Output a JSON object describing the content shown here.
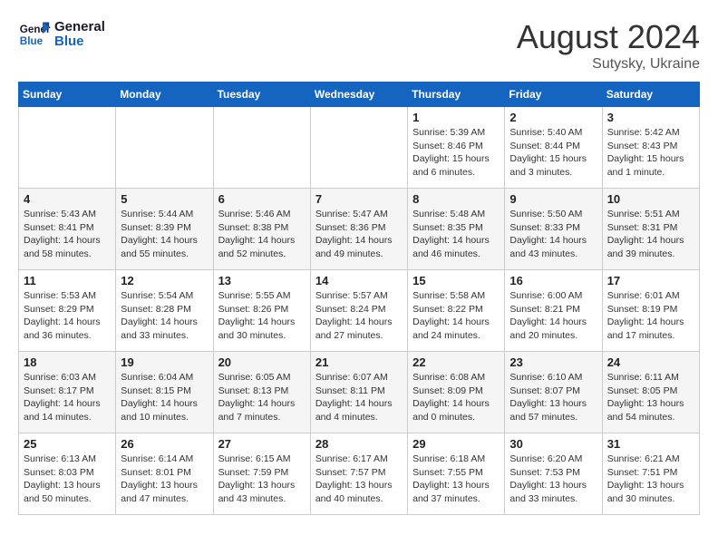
{
  "header": {
    "logo_line1": "General",
    "logo_line2": "Blue",
    "month_year": "August 2024",
    "location": "Sutysky, Ukraine"
  },
  "weekdays": [
    "Sunday",
    "Monday",
    "Tuesday",
    "Wednesday",
    "Thursday",
    "Friday",
    "Saturday"
  ],
  "weeks": [
    [
      {
        "day": "",
        "info": ""
      },
      {
        "day": "",
        "info": ""
      },
      {
        "day": "",
        "info": ""
      },
      {
        "day": "",
        "info": ""
      },
      {
        "day": "1",
        "info": "Sunrise: 5:39 AM\nSunset: 8:46 PM\nDaylight: 15 hours\nand 6 minutes."
      },
      {
        "day": "2",
        "info": "Sunrise: 5:40 AM\nSunset: 8:44 PM\nDaylight: 15 hours\nand 3 minutes."
      },
      {
        "day": "3",
        "info": "Sunrise: 5:42 AM\nSunset: 8:43 PM\nDaylight: 15 hours\nand 1 minute."
      }
    ],
    [
      {
        "day": "4",
        "info": "Sunrise: 5:43 AM\nSunset: 8:41 PM\nDaylight: 14 hours\nand 58 minutes."
      },
      {
        "day": "5",
        "info": "Sunrise: 5:44 AM\nSunset: 8:39 PM\nDaylight: 14 hours\nand 55 minutes."
      },
      {
        "day": "6",
        "info": "Sunrise: 5:46 AM\nSunset: 8:38 PM\nDaylight: 14 hours\nand 52 minutes."
      },
      {
        "day": "7",
        "info": "Sunrise: 5:47 AM\nSunset: 8:36 PM\nDaylight: 14 hours\nand 49 minutes."
      },
      {
        "day": "8",
        "info": "Sunrise: 5:48 AM\nSunset: 8:35 PM\nDaylight: 14 hours\nand 46 minutes."
      },
      {
        "day": "9",
        "info": "Sunrise: 5:50 AM\nSunset: 8:33 PM\nDaylight: 14 hours\nand 43 minutes."
      },
      {
        "day": "10",
        "info": "Sunrise: 5:51 AM\nSunset: 8:31 PM\nDaylight: 14 hours\nand 39 minutes."
      }
    ],
    [
      {
        "day": "11",
        "info": "Sunrise: 5:53 AM\nSunset: 8:29 PM\nDaylight: 14 hours\nand 36 minutes."
      },
      {
        "day": "12",
        "info": "Sunrise: 5:54 AM\nSunset: 8:28 PM\nDaylight: 14 hours\nand 33 minutes."
      },
      {
        "day": "13",
        "info": "Sunrise: 5:55 AM\nSunset: 8:26 PM\nDaylight: 14 hours\nand 30 minutes."
      },
      {
        "day": "14",
        "info": "Sunrise: 5:57 AM\nSunset: 8:24 PM\nDaylight: 14 hours\nand 27 minutes."
      },
      {
        "day": "15",
        "info": "Sunrise: 5:58 AM\nSunset: 8:22 PM\nDaylight: 14 hours\nand 24 minutes."
      },
      {
        "day": "16",
        "info": "Sunrise: 6:00 AM\nSunset: 8:21 PM\nDaylight: 14 hours\nand 20 minutes."
      },
      {
        "day": "17",
        "info": "Sunrise: 6:01 AM\nSunset: 8:19 PM\nDaylight: 14 hours\nand 17 minutes."
      }
    ],
    [
      {
        "day": "18",
        "info": "Sunrise: 6:03 AM\nSunset: 8:17 PM\nDaylight: 14 hours\nand 14 minutes."
      },
      {
        "day": "19",
        "info": "Sunrise: 6:04 AM\nSunset: 8:15 PM\nDaylight: 14 hours\nand 10 minutes."
      },
      {
        "day": "20",
        "info": "Sunrise: 6:05 AM\nSunset: 8:13 PM\nDaylight: 14 hours\nand 7 minutes."
      },
      {
        "day": "21",
        "info": "Sunrise: 6:07 AM\nSunset: 8:11 PM\nDaylight: 14 hours\nand 4 minutes."
      },
      {
        "day": "22",
        "info": "Sunrise: 6:08 AM\nSunset: 8:09 PM\nDaylight: 14 hours\nand 0 minutes."
      },
      {
        "day": "23",
        "info": "Sunrise: 6:10 AM\nSunset: 8:07 PM\nDaylight: 13 hours\nand 57 minutes."
      },
      {
        "day": "24",
        "info": "Sunrise: 6:11 AM\nSunset: 8:05 PM\nDaylight: 13 hours\nand 54 minutes."
      }
    ],
    [
      {
        "day": "25",
        "info": "Sunrise: 6:13 AM\nSunset: 8:03 PM\nDaylight: 13 hours\nand 50 minutes."
      },
      {
        "day": "26",
        "info": "Sunrise: 6:14 AM\nSunset: 8:01 PM\nDaylight: 13 hours\nand 47 minutes."
      },
      {
        "day": "27",
        "info": "Sunrise: 6:15 AM\nSunset: 7:59 PM\nDaylight: 13 hours\nand 43 minutes."
      },
      {
        "day": "28",
        "info": "Sunrise: 6:17 AM\nSunset: 7:57 PM\nDaylight: 13 hours\nand 40 minutes."
      },
      {
        "day": "29",
        "info": "Sunrise: 6:18 AM\nSunset: 7:55 PM\nDaylight: 13 hours\nand 37 minutes."
      },
      {
        "day": "30",
        "info": "Sunrise: 6:20 AM\nSunset: 7:53 PM\nDaylight: 13 hours\nand 33 minutes."
      },
      {
        "day": "31",
        "info": "Sunrise: 6:21 AM\nSunset: 7:51 PM\nDaylight: 13 hours\nand 30 minutes."
      }
    ]
  ]
}
